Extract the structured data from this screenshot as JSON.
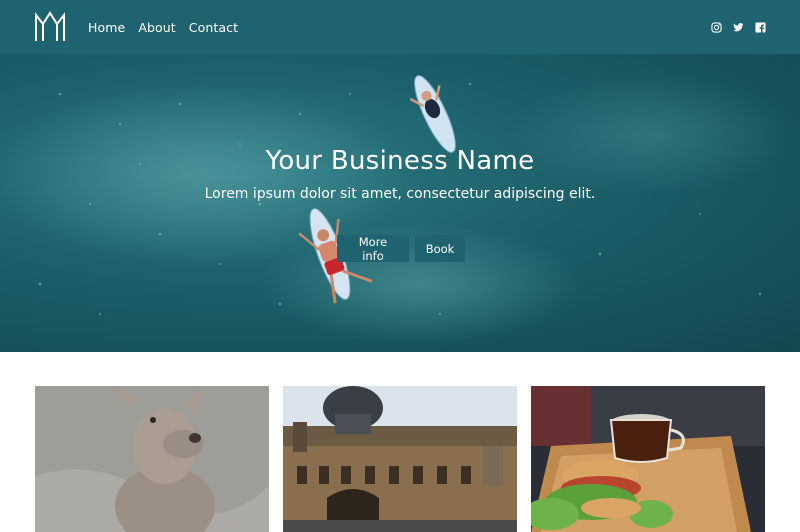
{
  "nav": {
    "logo_icon": "m-logo-icon",
    "links": [
      "Home",
      "About",
      "Contact"
    ],
    "social_icons": [
      "instagram-icon",
      "twitter-icon",
      "facebook-icon"
    ]
  },
  "hero": {
    "title": "Your Business Name",
    "subtitle": "Lorem ipsum dolor sit amet, consectetur adipiscing elit.",
    "buttons": [
      "More info",
      "Book"
    ]
  },
  "cards": [
    {
      "image": "kangaroo-photo"
    },
    {
      "image": "station-building-photo"
    },
    {
      "image": "sandwich-coffee-photo"
    }
  ],
  "colors": {
    "primary": "#1f6370",
    "ocean_dark": "#13474f",
    "ocean_light": "#2c7b83",
    "background": "#ffffff"
  }
}
